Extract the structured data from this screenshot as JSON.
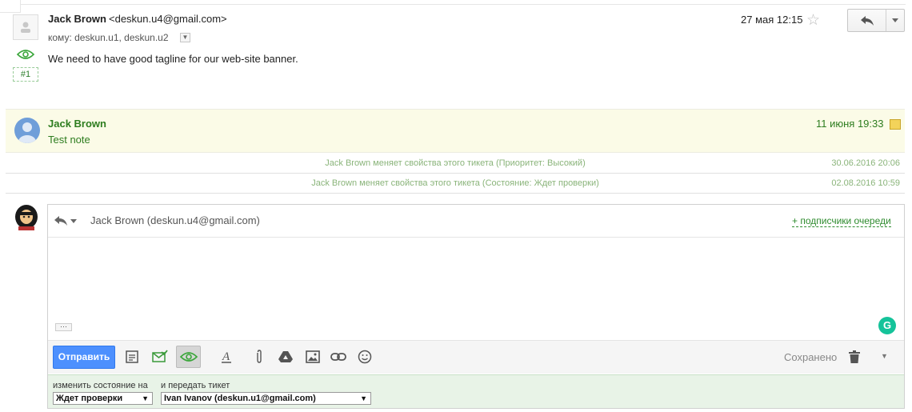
{
  "message": {
    "sender_name": "Jack Brown",
    "sender_email": "<deskun.u4@gmail.com>",
    "to_line": "кому: deskun.u1, deskun.u2",
    "body": "We need to have good tagline for our web-site banner.",
    "date": "27 мая 12:15",
    "number_badge": "#1"
  },
  "note": {
    "sender_name": "Jack Brown",
    "body": "Test note",
    "date": "11 июня 19:33"
  },
  "events": [
    {
      "text": "Jack Brown меняет свойства этого тикета (Приоритет: Высокий)",
      "date": "30.06.2016 20:06"
    },
    {
      "text": "Jack Brown меняет свойства этого тикета (Состояние: Ждет проверки)",
      "date": "02.08.2016 10:59"
    }
  ],
  "composer": {
    "to": "Jack Brown (deskun.u4@gmail.com)",
    "subscribers_link": "+ подписчики очереди",
    "more_dots": "···",
    "grammarly": "G",
    "send_label": "Отправить",
    "saved_label": "Сохранено",
    "state_label": "изменить состояние на",
    "state_value": "Ждет проверки",
    "transfer_label": "и передать тикет",
    "transfer_value": "Ivan Ivanov (deskun.u1@gmail.com)"
  },
  "colors": {
    "accent_green": "#2e7d1f",
    "send_blue": "#4d90fe",
    "note_bg": "#fbfbe7",
    "status_bg": "#e8f3e7"
  },
  "icons": [
    "person-icon",
    "eye-icon",
    "star-icon",
    "reply-icon",
    "chevron-down-icon",
    "note-icon",
    "template-icon",
    "mark-done-icon",
    "text-format-icon",
    "attach-icon",
    "drive-icon",
    "image-icon",
    "link-icon",
    "emoji-icon",
    "trash-icon",
    "grammarly-icon"
  ]
}
